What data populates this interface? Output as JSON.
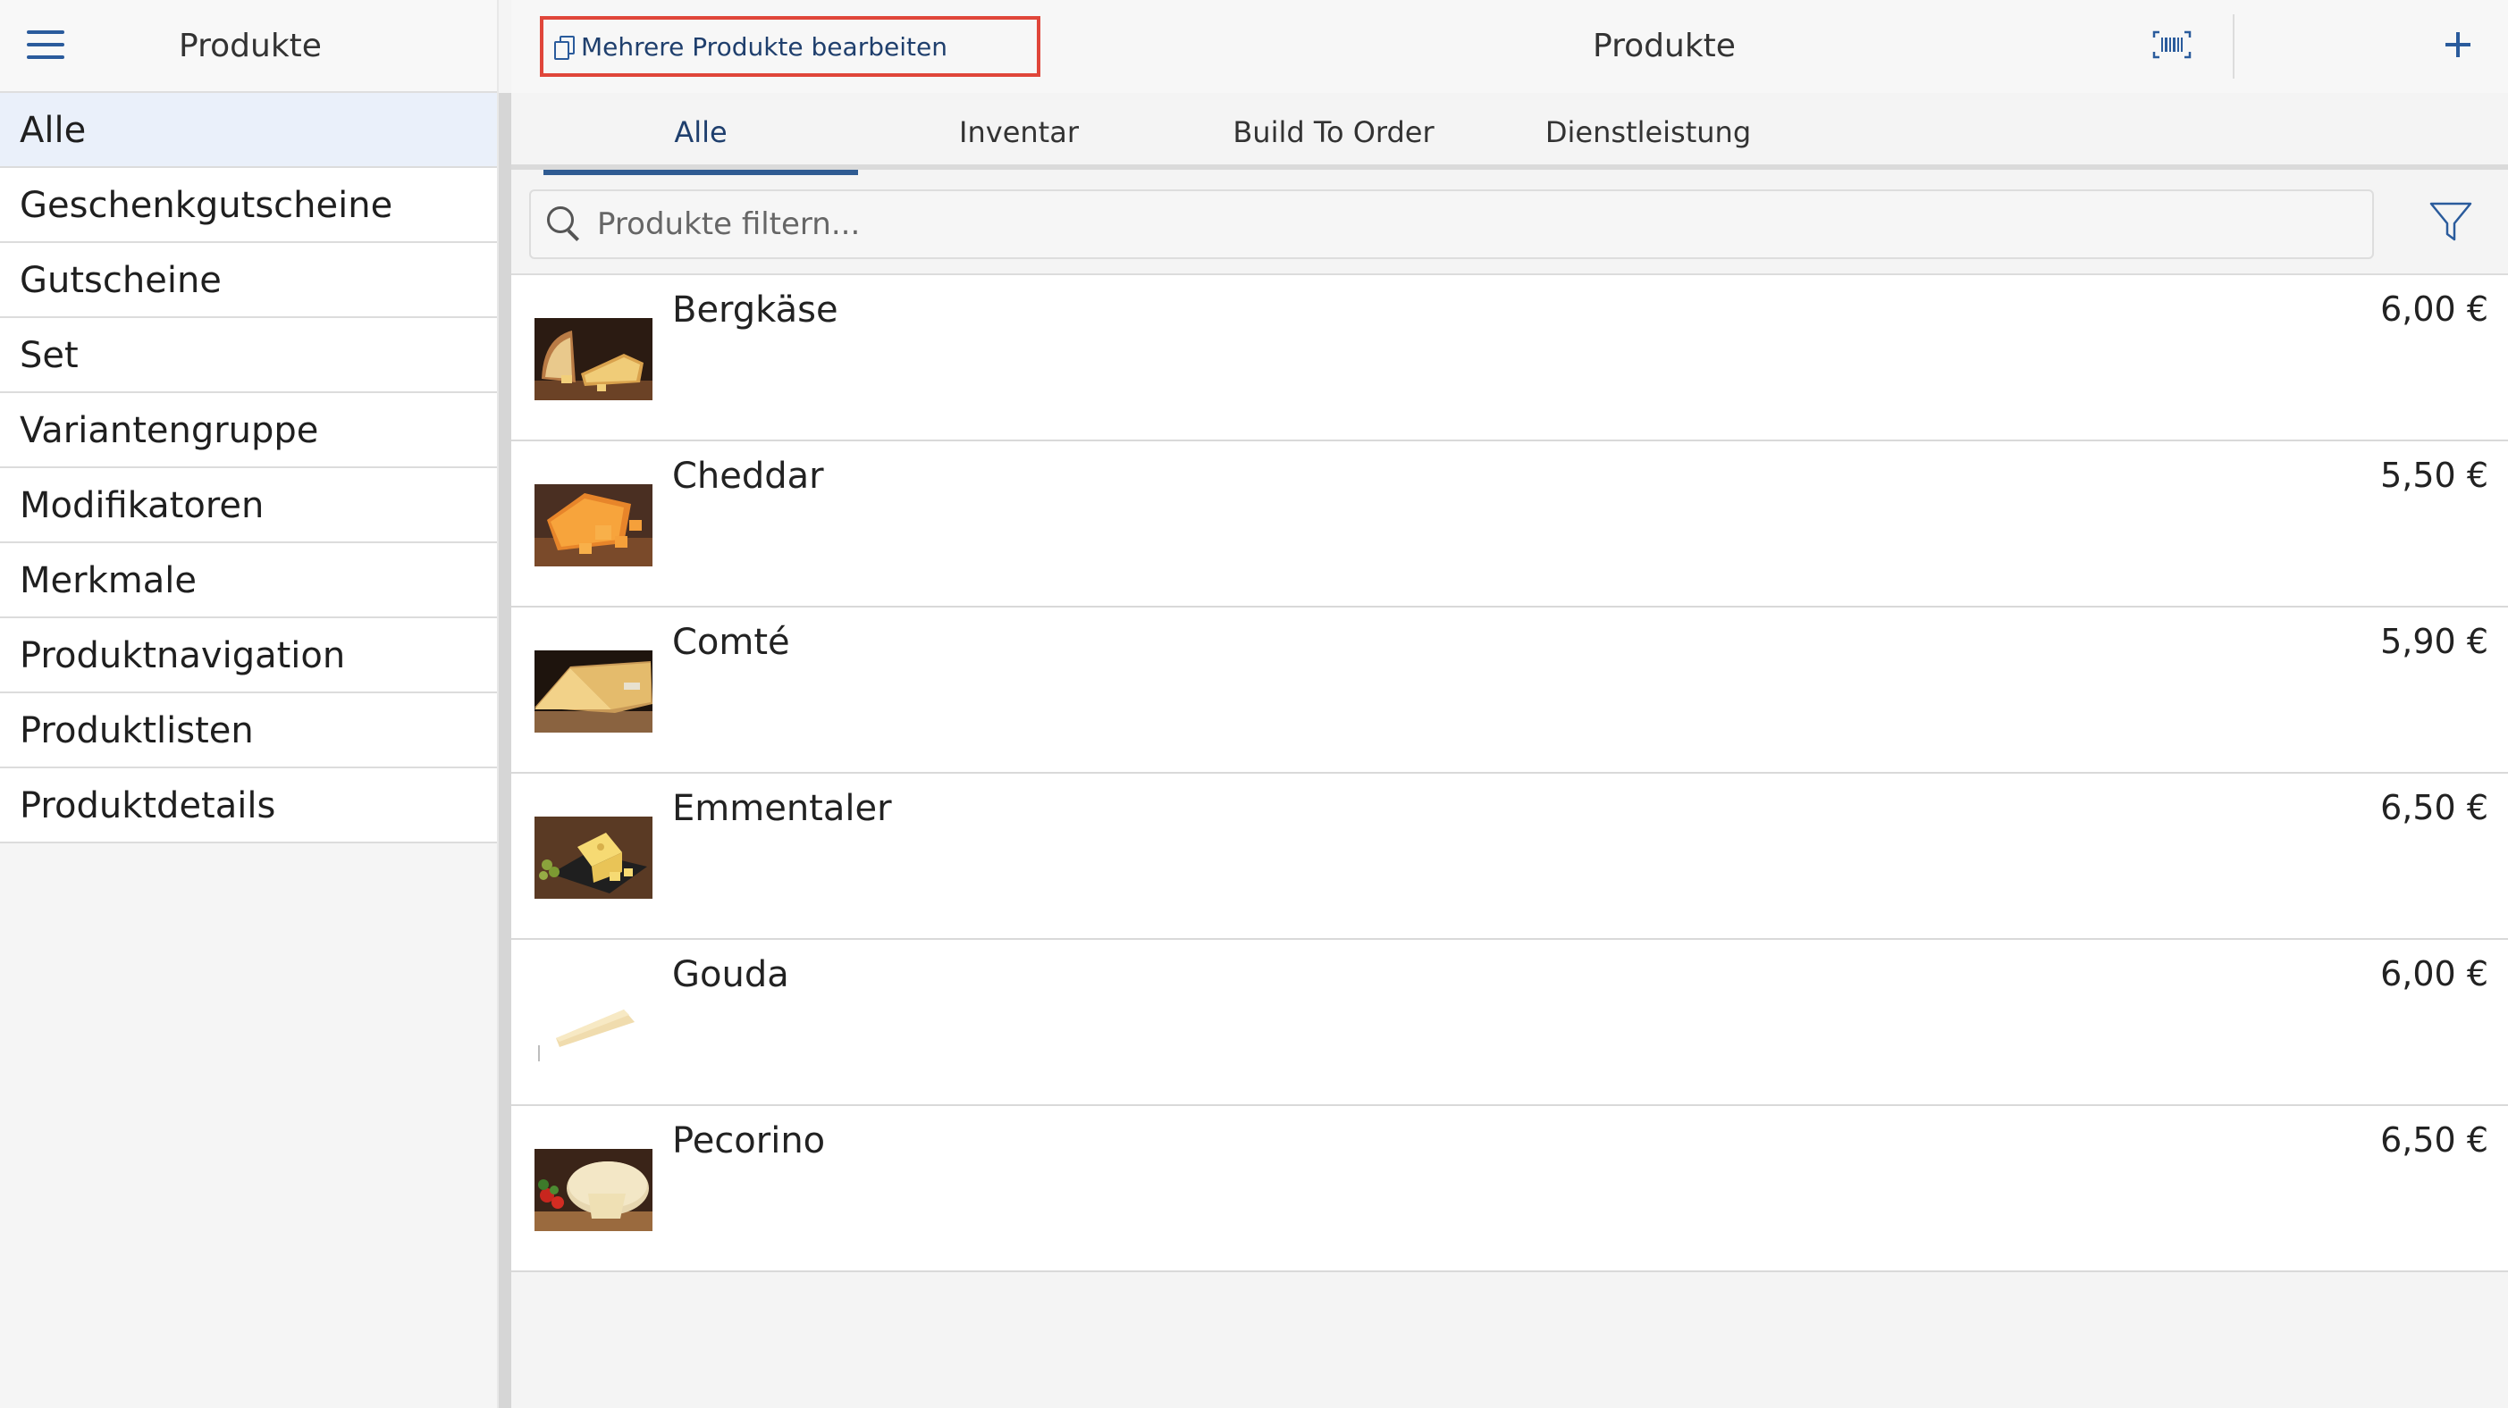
{
  "sidebar": {
    "title": "Produkte",
    "items": [
      {
        "label": "Alle"
      },
      {
        "label": "Geschenkgutscheine"
      },
      {
        "label": "Gutscheine"
      },
      {
        "label": "Set"
      },
      {
        "label": "Variantengruppe"
      },
      {
        "label": "Modifikatoren"
      },
      {
        "label": "Merkmale"
      },
      {
        "label": "Produktnavigation"
      },
      {
        "label": "Produktlisten"
      },
      {
        "label": "Produktdetails"
      }
    ]
  },
  "toolbar": {
    "edit_multiple_label": "Mehrere Produkte bearbeiten",
    "title": "Produkte"
  },
  "tabs": [
    {
      "label": "Alle"
    },
    {
      "label": "Inventar"
    },
    {
      "label": "Build To Order"
    },
    {
      "label": "Dienstleistung"
    }
  ],
  "search": {
    "placeholder": "Produkte filtern..."
  },
  "products": [
    {
      "name": "Bergkäse",
      "price": "6,00 €"
    },
    {
      "name": "Cheddar",
      "price": "5,50 €"
    },
    {
      "name": "Comté",
      "price": "5,90 €"
    },
    {
      "name": "Emmentaler",
      "price": "6,50 €"
    },
    {
      "name": "Gouda",
      "price": "6,00 €"
    },
    {
      "name": "Pecorino",
      "price": "6,50 €"
    }
  ],
  "colors": {
    "accent": "#2a5b9c",
    "highlight_border": "#e0463a",
    "active_sidebar_bg": "#eaf0fa"
  }
}
